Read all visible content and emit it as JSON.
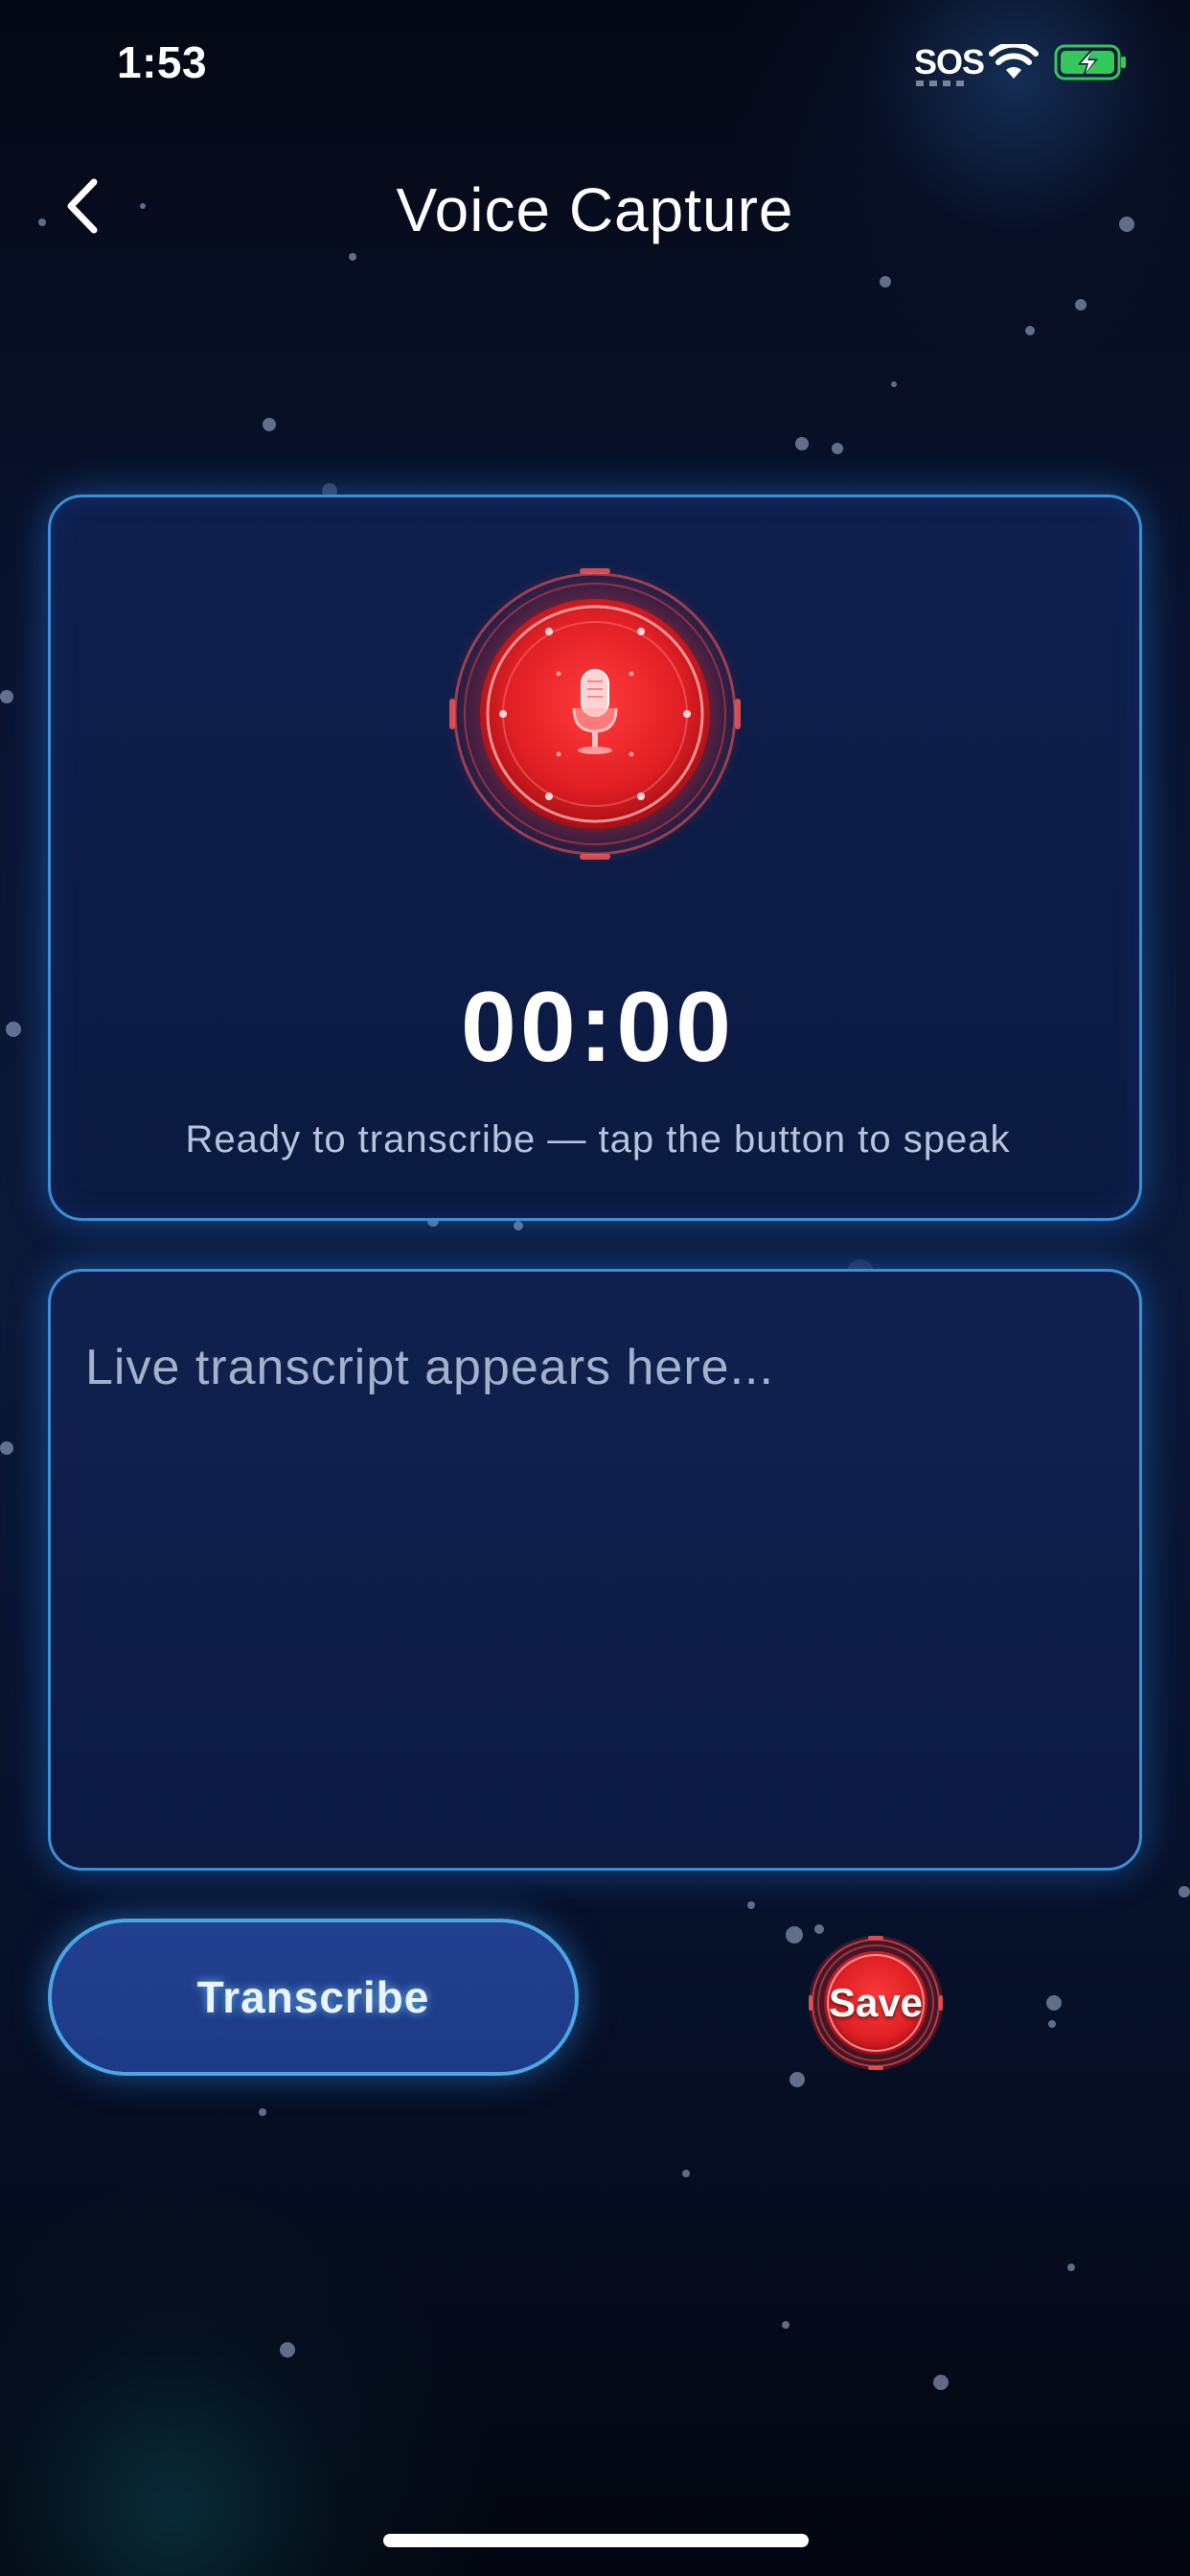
{
  "status_bar": {
    "time": "1:53",
    "sos": "SOS",
    "wifi_icon": "wifi-icon",
    "battery_icon": "battery-charging-icon",
    "battery_color": "#34c759"
  },
  "nav": {
    "back_icon": "chevron-left-icon",
    "title": "Voice Capture"
  },
  "recorder": {
    "mic_icon": "microphone-icon",
    "timer": "00:00",
    "status": "Ready to transcribe — tap the button to speak"
  },
  "transcript": {
    "placeholder": "Live transcript appears here...",
    "value": ""
  },
  "actions": {
    "transcribe_label": "Transcribe",
    "save_label": "Save"
  },
  "colors": {
    "accent_border": "#3a8fd6",
    "record_red": "#e5242b",
    "panel_bg": "#0f1f4d"
  }
}
